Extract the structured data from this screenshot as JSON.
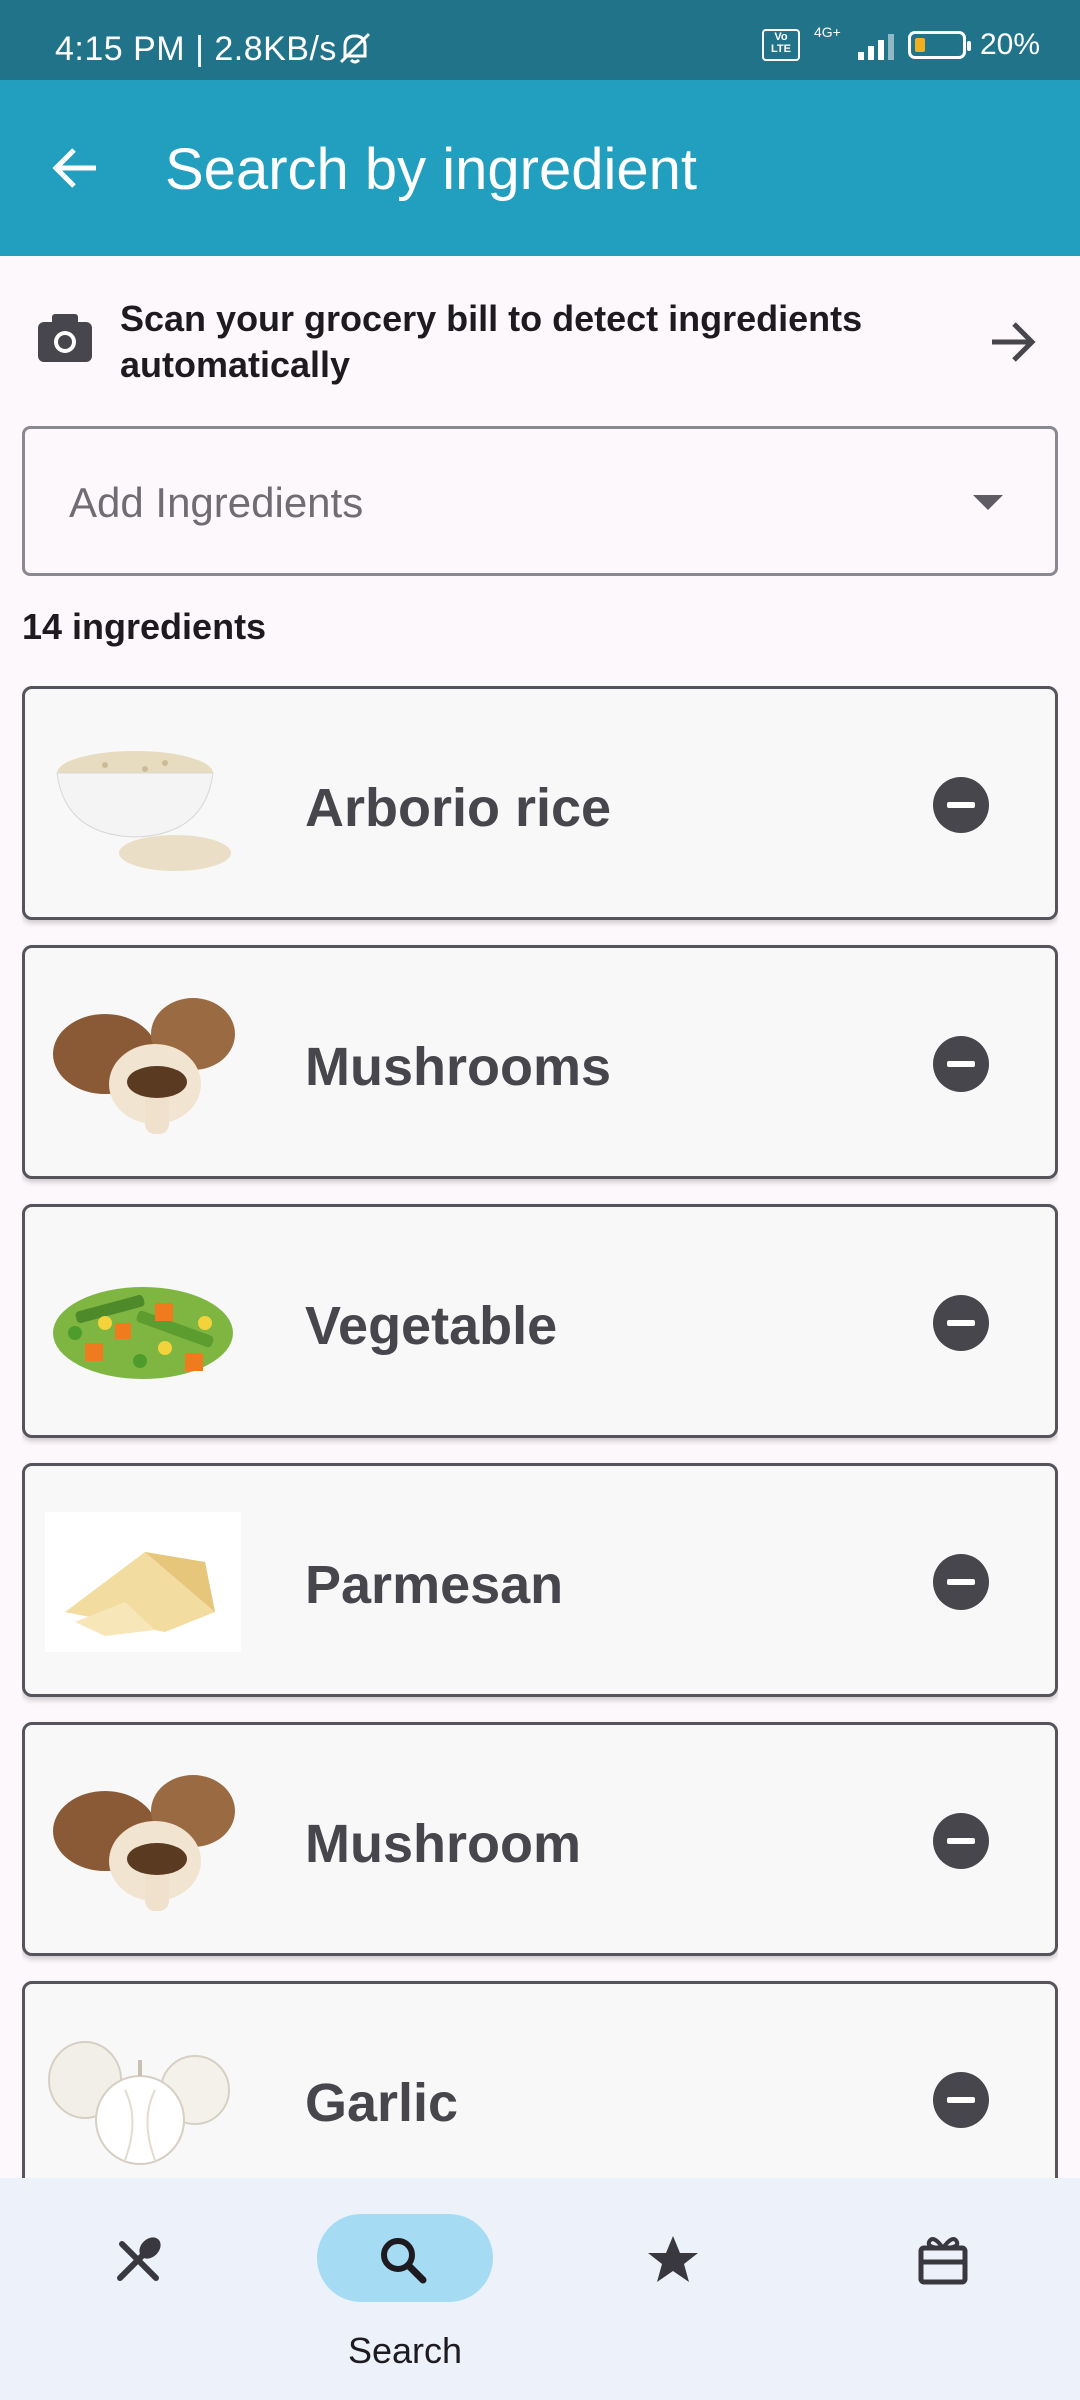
{
  "status_bar": {
    "time_speed": "4:15 PM | 2.8KB/s",
    "volte": "Vo LTE",
    "network": "4G+",
    "battery_percent": "20%"
  },
  "app_bar": {
    "title": "Search by ingredient",
    "back_icon": "arrow-back-icon"
  },
  "scan_banner": {
    "text": "Scan your grocery bill to detect ingredients automatically",
    "camera_icon": "camera-icon",
    "arrow_icon": "arrow-forward-icon"
  },
  "dropdown": {
    "placeholder": "Add Ingredients"
  },
  "ingredient_count": "14 ingredients",
  "ingredients": [
    {
      "name": "Arborio rice",
      "image": "rice-bowl"
    },
    {
      "name": "Mushrooms",
      "image": "mushrooms"
    },
    {
      "name": "Vegetable",
      "image": "mixed-vegetables"
    },
    {
      "name": "Parmesan",
      "image": "parmesan-cheese"
    },
    {
      "name": "Mushroom",
      "image": "mushrooms"
    },
    {
      "name": "Garlic",
      "image": "garlic"
    }
  ],
  "bottom_nav": {
    "items": [
      {
        "icon": "utensils-icon",
        "label": ""
      },
      {
        "icon": "search-icon",
        "label": "Search",
        "active": true
      },
      {
        "icon": "star-icon",
        "label": ""
      },
      {
        "icon": "gift-icon",
        "label": ""
      }
    ]
  },
  "colors": {
    "status_bar": "#21738a",
    "app_bar": "#229fbf",
    "active_pill": "#a5dcf4",
    "nav_background": "#edf1f9"
  }
}
